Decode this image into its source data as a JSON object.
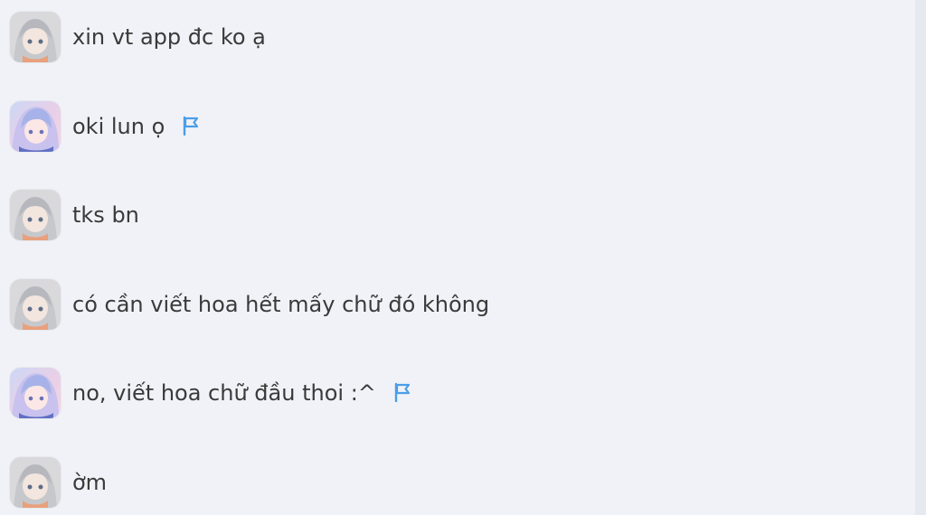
{
  "chat": {
    "messages": [
      {
        "text": "xin vt app đc ko ạ",
        "avatar": "gray-hair-avatar",
        "flag": false
      },
      {
        "text": "oki lun ọ",
        "avatar": "pastel-hair-avatar",
        "flag": true
      },
      {
        "text": "tks bn",
        "avatar": "gray-hair-avatar",
        "flag": false
      },
      {
        "text": "có cần viết hoa hết mấy chữ đó không",
        "avatar": "gray-hair-avatar",
        "flag": false
      },
      {
        "text": "no, viết hoa chữ đầu thoi :^",
        "avatar": "pastel-hair-avatar",
        "flag": true
      },
      {
        "text": "ờm",
        "avatar": "gray-hair-avatar",
        "flag": false
      }
    ]
  },
  "icons": {
    "flag": "flag-icon"
  },
  "colors": {
    "background": "#f0f2f7",
    "text": "#3a3a3a",
    "flag": "#4a9ee8"
  }
}
